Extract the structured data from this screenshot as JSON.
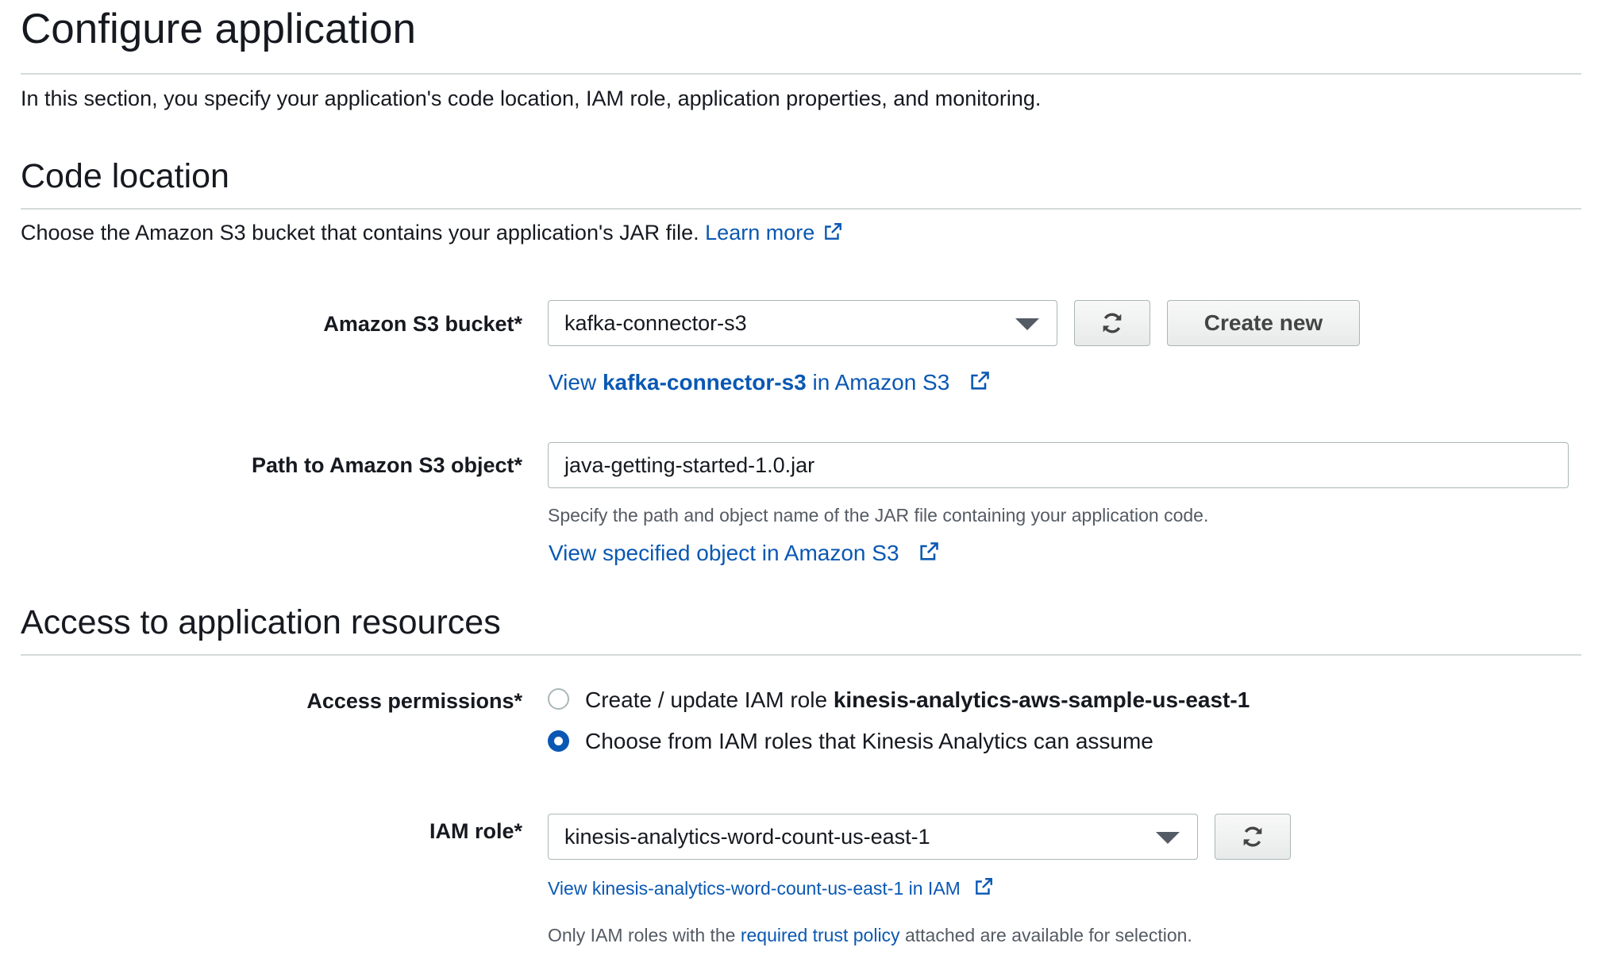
{
  "page": {
    "title": "Configure application",
    "intro": "In this section, you specify your application's code location, IAM role, application properties, and monitoring."
  },
  "code_location": {
    "heading": "Code location",
    "description": "Choose the Amazon S3 bucket that contains your application's JAR file.",
    "learn_more": "Learn more",
    "bucket_label": "Amazon S3 bucket*",
    "bucket_value": "kafka-connector-s3",
    "create_new_label": "Create new",
    "view_bucket_prefix": "View",
    "view_bucket_name": "kafka-connector-s3",
    "view_bucket_suffix": "in Amazon S3",
    "path_label": "Path to Amazon S3 object*",
    "path_value": "java-getting-started-1.0.jar",
    "path_hint": "Specify the path and object name of the JAR file containing your application code.",
    "view_object_link": "View specified object in Amazon S3"
  },
  "access": {
    "heading": "Access to application resources",
    "permissions_label": "Access permissions*",
    "option1_prefix": "Create / update IAM role",
    "option1_role": "kinesis-analytics-aws-sample-us-east-1",
    "option2": "Choose from IAM roles that Kinesis Analytics can assume",
    "selected_option": 2,
    "iam_role_label": "IAM role*",
    "iam_role_value": "kinesis-analytics-word-count-us-east-1",
    "view_role_link": "View kinesis-analytics-word-count-us-east-1 in IAM",
    "trust_note_prefix": "Only IAM roles with the",
    "trust_note_link": "required trust policy",
    "trust_note_suffix": "attached are available for selection."
  },
  "icons": {
    "refresh": "refresh-icon",
    "external": "external-link-icon",
    "dropdown": "chevron-down-icon"
  },
  "colors": {
    "link": "#0a58b3",
    "radio_selected": "#0a58b3",
    "border": "#aab7b8"
  }
}
